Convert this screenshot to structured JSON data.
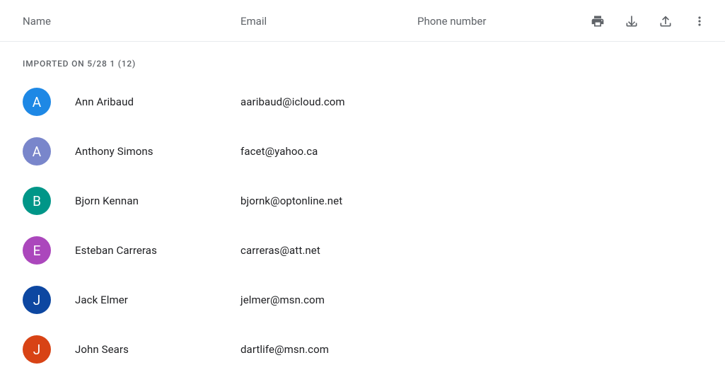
{
  "header": {
    "name": "Name",
    "email": "Email",
    "phone": "Phone number"
  },
  "section": {
    "title": "IMPORTED ON 5/28 1 (12)"
  },
  "contacts": [
    {
      "initial": "A",
      "color": "#1e88e5",
      "name": "Ann Aribaud",
      "email": "aaribaud@icloud.com",
      "phone": ""
    },
    {
      "initial": "A",
      "color": "#7986cb",
      "name": "Anthony Simons",
      "email": "facet@yahoo.ca",
      "phone": ""
    },
    {
      "initial": "B",
      "color": "#009688",
      "name": "Bjorn Kennan",
      "email": "bjornk@optonline.net",
      "phone": ""
    },
    {
      "initial": "E",
      "color": "#ab47bc",
      "name": "Esteban Carreras",
      "email": "carreras@att.net",
      "phone": ""
    },
    {
      "initial": "J",
      "color": "#0d47a1",
      "name": "Jack Elmer",
      "email": "jelmer@msn.com",
      "phone": ""
    },
    {
      "initial": "J",
      "color": "#d84315",
      "name": "John Sears",
      "email": "dartlife@msn.com",
      "phone": ""
    }
  ]
}
